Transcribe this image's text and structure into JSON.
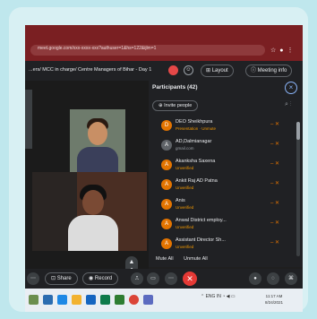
{
  "browser": {
    "url": "meet.google.com/xxx-xxxx-xxx?authuser=1&hs=122&ijlm=1"
  },
  "meeting": {
    "title": "...ers/ MCC in charge/ Centre Managers of Bihar - Day 1",
    "layout_label": "Layout",
    "meeting_info_label": "Meeting info"
  },
  "panel": {
    "title": "Participants (42)",
    "invite_label": "Invite people",
    "participants": [
      {
        "name": "DEO Sheikhpura",
        "sub": "Presentation · Unmute",
        "initial": "D",
        "color": "#e37400"
      },
      {
        "name": "AD,Dalmianagar",
        "sub": "gmail.com",
        "initial": "A",
        "color": "#5f6368"
      },
      {
        "name": "Akanksha Saxena",
        "sub": "Unverified",
        "initial": "A",
        "color": "#e37400"
      },
      {
        "name": "Ankit Raj AD Patna",
        "sub": "Unverified",
        "initial": "A",
        "color": "#e37400"
      },
      {
        "name": "Anis",
        "sub": "Unverified",
        "initial": "A",
        "color": "#e37400"
      },
      {
        "name": "Anwal District employ...",
        "sub": "Unverified",
        "initial": "A",
        "color": "#e37400"
      },
      {
        "name": "Assistant Director Sh...",
        "sub": "Unverified",
        "initial": "A",
        "color": "#e37400"
      }
    ],
    "mute_all_label": "Mute All",
    "unmute_all_label": "Unmute All"
  },
  "controls": {
    "share_label": "Share",
    "record_label": "Record"
  },
  "taskbar": {
    "tray_text": "ENG IN",
    "time": "11:17 AM",
    "date": "8/24/2021"
  }
}
